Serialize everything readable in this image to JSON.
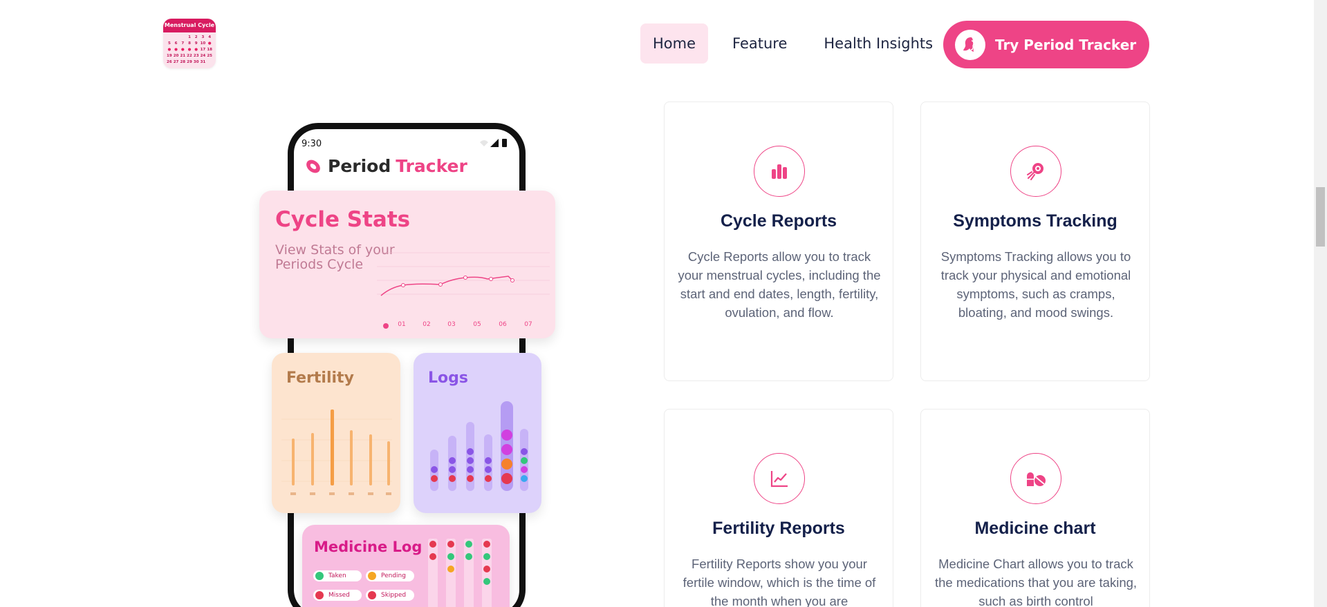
{
  "logo": {
    "title": "Menstrual Cycle",
    "days": [
      "",
      "",
      "",
      "1",
      "2",
      "3",
      "4",
      "5",
      "6",
      "7",
      "8",
      "9",
      "10",
      "11",
      "12",
      "13",
      "14",
      "15",
      "16",
      "17",
      "18",
      "19",
      "20",
      "21",
      "22",
      "23",
      "24",
      "25",
      "26",
      "27",
      "28",
      "29",
      "30",
      "31",
      ""
    ]
  },
  "nav": {
    "items": [
      {
        "label": "Home",
        "active": true
      },
      {
        "label": "Feature",
        "active": false
      },
      {
        "label": "Health Insights",
        "active": false
      }
    ],
    "cta_label": "Try Period Tracker"
  },
  "phone": {
    "time": "9:30",
    "app_name_part1": "Period",
    "app_name_part2": "Tracker",
    "cycle_card": {
      "title": "Cycle Stats",
      "subtitle": "View Stats of your Periods Cycle",
      "x_labels": [
        "01",
        "02",
        "03",
        "05",
        "06",
        "07"
      ]
    },
    "fertility_card": {
      "title": "Fertility"
    },
    "logs_card": {
      "title": "Logs"
    },
    "medicine_card": {
      "title": "Medicine Log",
      "legend": [
        {
          "label": "Taken",
          "color": "#34c77b"
        },
        {
          "label": "Pending",
          "color": "#f5a623"
        },
        {
          "label": "Missed",
          "color": "#e53950"
        },
        {
          "label": "Skipped",
          "color": "#e53950"
        }
      ]
    }
  },
  "features": [
    {
      "title": "Cycle Reports",
      "icon": "bar-chart-icon",
      "text": "Cycle Reports allow you to track your menstrual cycles, including the start and end dates, length, fertility, ovulation, and flow."
    },
    {
      "title": "Symptoms Tracking",
      "icon": "target-icon",
      "text": "Symptoms Tracking allows you to track your physical and emotional symptoms, such as cramps, bloating, and mood swings."
    },
    {
      "title": "Fertility Reports",
      "icon": "line-chart-icon",
      "text": "Fertility Reports show you your fertile window, which is the time of the month when you are"
    },
    {
      "title": "Medicine chart",
      "icon": "pills-icon",
      "text": "Medicine Chart allows you to track the medications that you are taking, such as birth control"
    }
  ],
  "colors": {
    "accent": "#ee4486",
    "heading": "#14204a",
    "body_text": "#5d6478"
  }
}
